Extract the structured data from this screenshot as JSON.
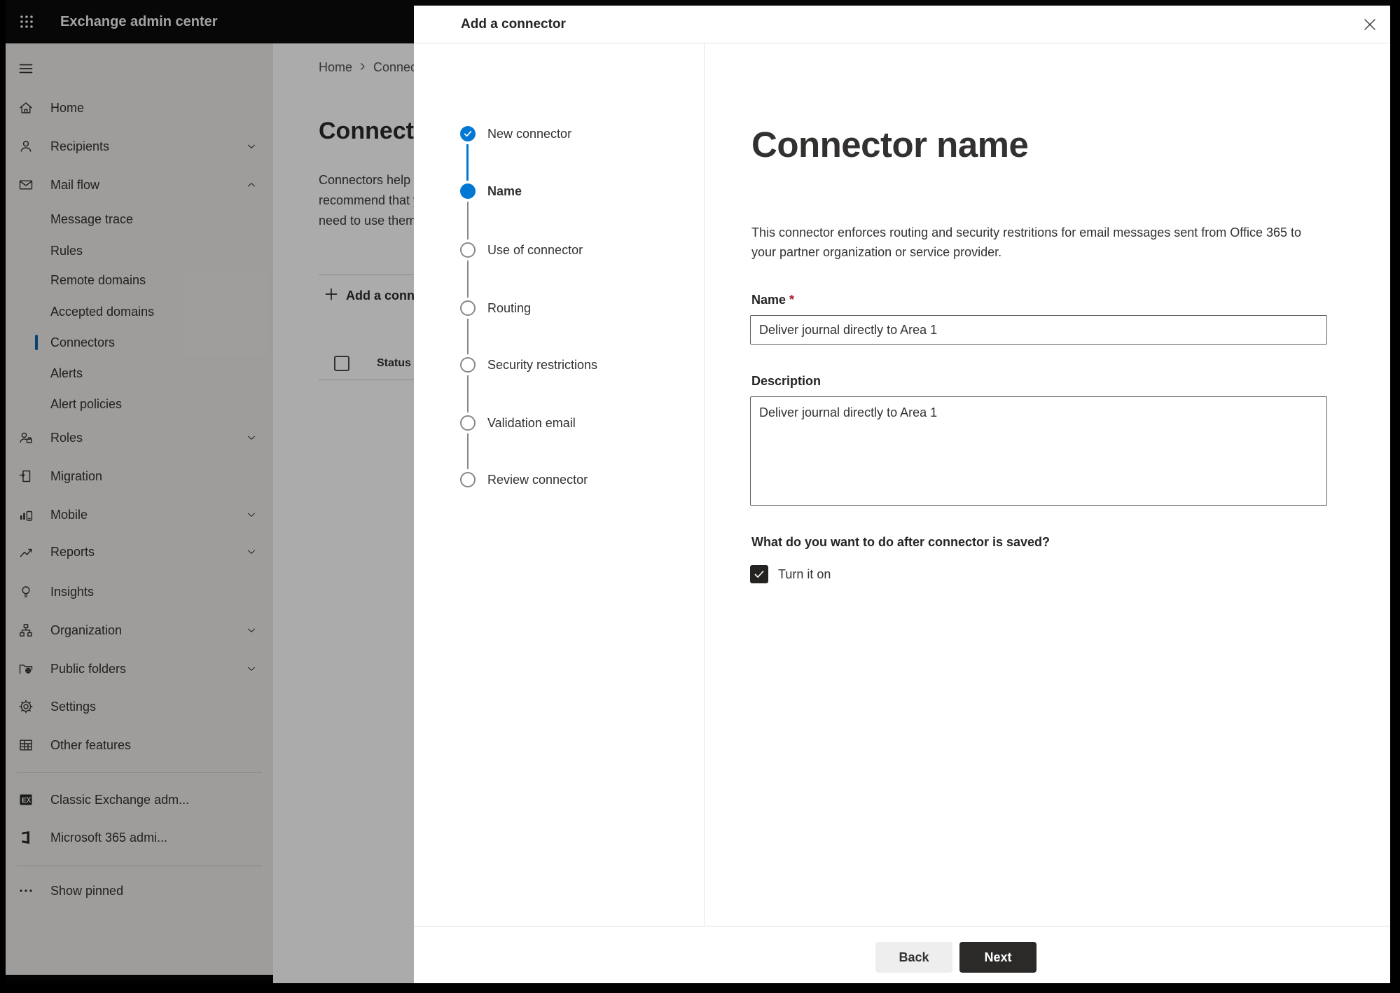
{
  "app_header": {
    "title": "Exchange admin center"
  },
  "sidebar": {
    "items": [
      {
        "label": "Home",
        "icon": "home-icon"
      },
      {
        "label": "Recipients",
        "icon": "person-icon",
        "chevron": "down"
      },
      {
        "label": "Mail flow",
        "icon": "mail-icon",
        "chevron": "up",
        "expanded": true
      },
      {
        "label": "Message trace",
        "indent": true
      },
      {
        "label": "Rules",
        "indent": true
      },
      {
        "label": "Remote domains",
        "indent": true
      },
      {
        "label": "Accepted domains",
        "indent": true
      },
      {
        "label": "Connectors",
        "indent": true,
        "selected": true
      },
      {
        "label": "Alerts",
        "indent": true
      },
      {
        "label": "Alert policies",
        "indent": true
      },
      {
        "label": "Roles",
        "icon": "roles-icon",
        "chevron": "down"
      },
      {
        "label": "Migration",
        "icon": "migration-icon"
      },
      {
        "label": "Mobile",
        "icon": "mobile-icon",
        "chevron": "down"
      },
      {
        "label": "Reports",
        "icon": "reports-icon",
        "chevron": "down"
      },
      {
        "label": "Insights",
        "icon": "lightbulb-icon"
      },
      {
        "label": "Organization",
        "icon": "org-chart-icon",
        "chevron": "down"
      },
      {
        "label": "Public folders",
        "icon": "folder-globe-icon",
        "chevron": "down"
      },
      {
        "label": "Settings",
        "icon": "gear-icon"
      },
      {
        "label": "Other features",
        "icon": "table-icon"
      }
    ],
    "footer_items": [
      {
        "label": "Classic Exchange adm...",
        "icon": "exchange-logo-icon"
      },
      {
        "label": "Microsoft 365 admi...",
        "icon": "office-logo-icon"
      }
    ],
    "show_pinned_label": "Show pinned"
  },
  "page": {
    "breadcrumb_home": "Home",
    "breadcrumb_current": "Connectors",
    "title": "Connectors",
    "description_lines": [
      "Connectors help control the flow of email messages to and from your organization. We",
      "recommend that you first check whether you need to use connectors, because most",
      "need to use them."
    ],
    "add_button_label": "Add a connector",
    "status_column": "Status"
  },
  "dialog": {
    "title": "Add a connector",
    "steps": [
      {
        "label": "New connector",
        "state": "completed"
      },
      {
        "label": "Name",
        "state": "current"
      },
      {
        "label": "Use of connector",
        "state": "upcoming"
      },
      {
        "label": "Routing",
        "state": "upcoming"
      },
      {
        "label": "Security restrictions",
        "state": "upcoming"
      },
      {
        "label": "Validation email",
        "state": "upcoming"
      },
      {
        "label": "Review connector",
        "state": "upcoming"
      }
    ],
    "content": {
      "heading": "Connector name",
      "description": "This connector enforces routing and security restritions for email messages sent from Office 365 to your partner organization or service provider.",
      "name_label": "Name",
      "required_marker": "*",
      "name_value": "Deliver journal directly to Area 1",
      "description_label": "Description",
      "description_value": "Deliver journal directly to Area 1",
      "after_save_question": "What do you want to do after connector is saved?",
      "turn_on_label": "Turn it on",
      "turn_on_checked": true
    },
    "footer": {
      "back_label": "Back",
      "next_label": "Next"
    }
  },
  "colors": {
    "accent": "#0078d4",
    "required": "#a4262c",
    "primary_button": "#2b2a29",
    "header_bar": "#0b0b0b"
  }
}
